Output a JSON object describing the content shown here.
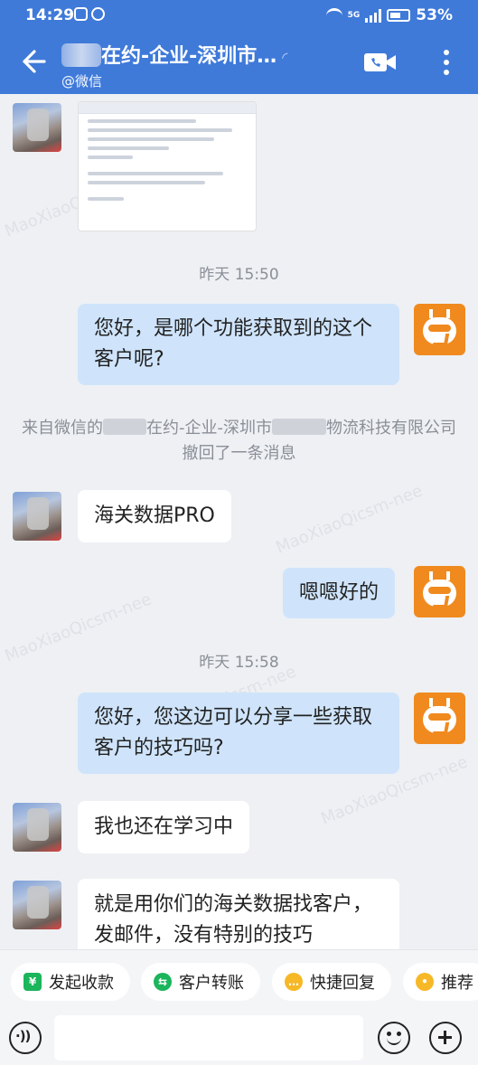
{
  "status_bar": {
    "time": "14:29",
    "network": "5G",
    "battery": "53%"
  },
  "header": {
    "title": "在约-企业-深圳市…",
    "subtitle": "@微信"
  },
  "watermark_text": "MaoXiaoQicsm-nee",
  "messages": {
    "time1": "昨天  15:50",
    "out1": "您好，是哪个功能获取到的这个客户呢?",
    "recall_prefix": "来自微信的",
    "recall_mid1": "在约-企业-深圳市",
    "recall_mid2": "物流科技有限公司",
    "recall_suffix": "撤回了一条消息",
    "in1": "海关数据PRO",
    "out2": "嗯嗯好的",
    "time2": "昨天  15:58",
    "out3": "您好，您这边可以分享一些获取客户的技巧吗?",
    "in2": "我也还在学习中",
    "in3": "就是用你们的海关数据找客户，发邮件，没有特别的技巧"
  },
  "quick_actions": [
    {
      "label": "发起收款",
      "icon": "yuan-icon",
      "color": "#1bb55c"
    },
    {
      "label": "客户转账",
      "icon": "transfer-icon",
      "color": "#1bb55c"
    },
    {
      "label": "快捷回复",
      "icon": "chat-icon",
      "color": "#f6b826"
    },
    {
      "label": "推荐",
      "icon": "recommend-icon",
      "color": "#f6b826"
    }
  ],
  "input": {
    "placeholder": ""
  },
  "colors": {
    "header": "#3f7ad9",
    "bubble_out": "#cfe4fb",
    "avatar_out": "#f08a1e"
  }
}
